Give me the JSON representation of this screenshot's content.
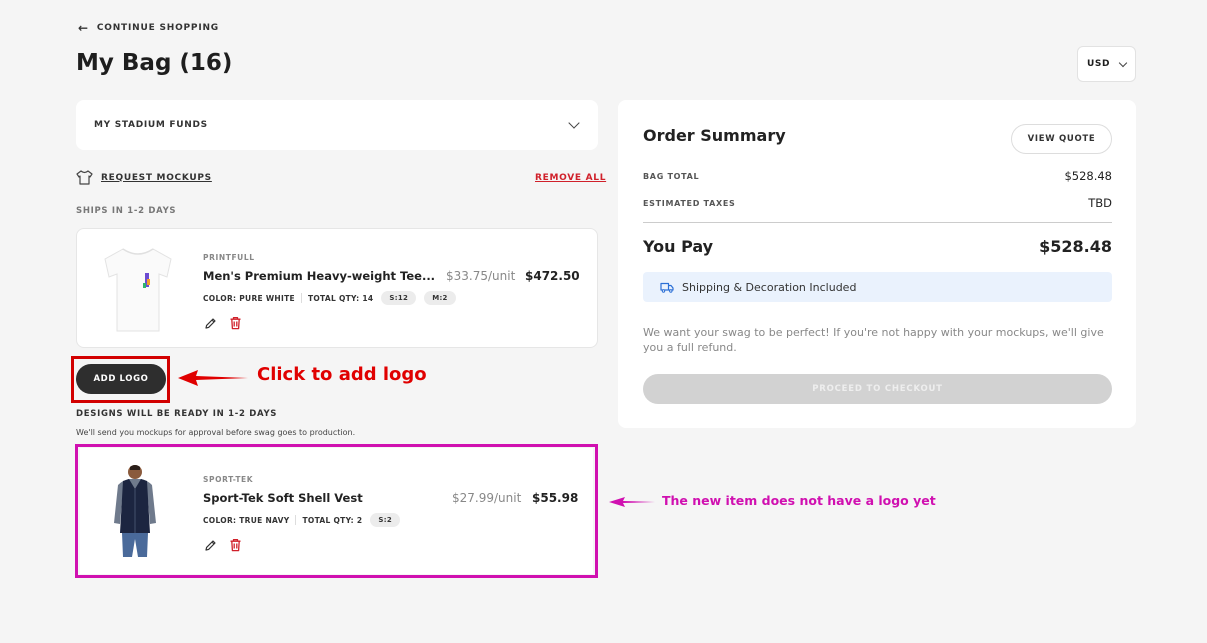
{
  "nav": {
    "continue_label": "CONTINUE SHOPPING"
  },
  "page": {
    "title": "My Bag (16)",
    "currency": "USD"
  },
  "funds": {
    "label": "MY STADIUM FUNDS"
  },
  "actions": {
    "request_mockups": "REQUEST MOCKUPS",
    "remove_all": "REMOVE ALL"
  },
  "sections": {
    "ships": "SHIPS IN 1-2 DAYS",
    "designs": "DESIGNS WILL BE READY IN 1-2 DAYS",
    "designs_note": "We'll send you mockups for approval before swag goes to production."
  },
  "items": [
    {
      "brand": "PRINTFULL",
      "name": "Men's Premium Heavy-weight Tee...",
      "unit_price": "$33.75/unit",
      "total": "$472.50",
      "color": "COLOR: PURE WHITE",
      "qty": "TOTAL QTY: 14",
      "sizes": [
        "S:12",
        "M:2"
      ]
    },
    {
      "brand": "SPORT-TEK",
      "name": "Sport-Tek Soft Shell Vest",
      "unit_price": "$27.99/unit",
      "total": "$55.98",
      "color": "COLOR: TRUE NAVY",
      "qty": "TOTAL QTY: 2",
      "sizes": [
        "S:2"
      ]
    }
  ],
  "add_logo": {
    "label": "ADD LOGO"
  },
  "annotations": {
    "add_logo_note": "Click to add logo",
    "no_logo_note": "The new item does not have a logo yet"
  },
  "summary": {
    "title": "Order Summary",
    "view_quote": "VIEW QUOTE",
    "bag_total_label": "BAG TOTAL",
    "bag_total_value": "$528.48",
    "taxes_label": "ESTIMATED TAXES",
    "taxes_value": "TBD",
    "you_pay_label": "You Pay",
    "you_pay_value": "$528.48",
    "shipping_note": "Shipping & Decoration Included",
    "refund_note": "We want your swag to be perfect! If you're not happy with your mockups, we'll give you a full refund.",
    "checkout_label": "PROCEED TO CHECKOUT"
  },
  "colors": {
    "danger": "#d0202a",
    "annotation_red": "#e00000",
    "annotation_magenta": "#d010b0",
    "shipping_bg": "#eaf2fd"
  }
}
